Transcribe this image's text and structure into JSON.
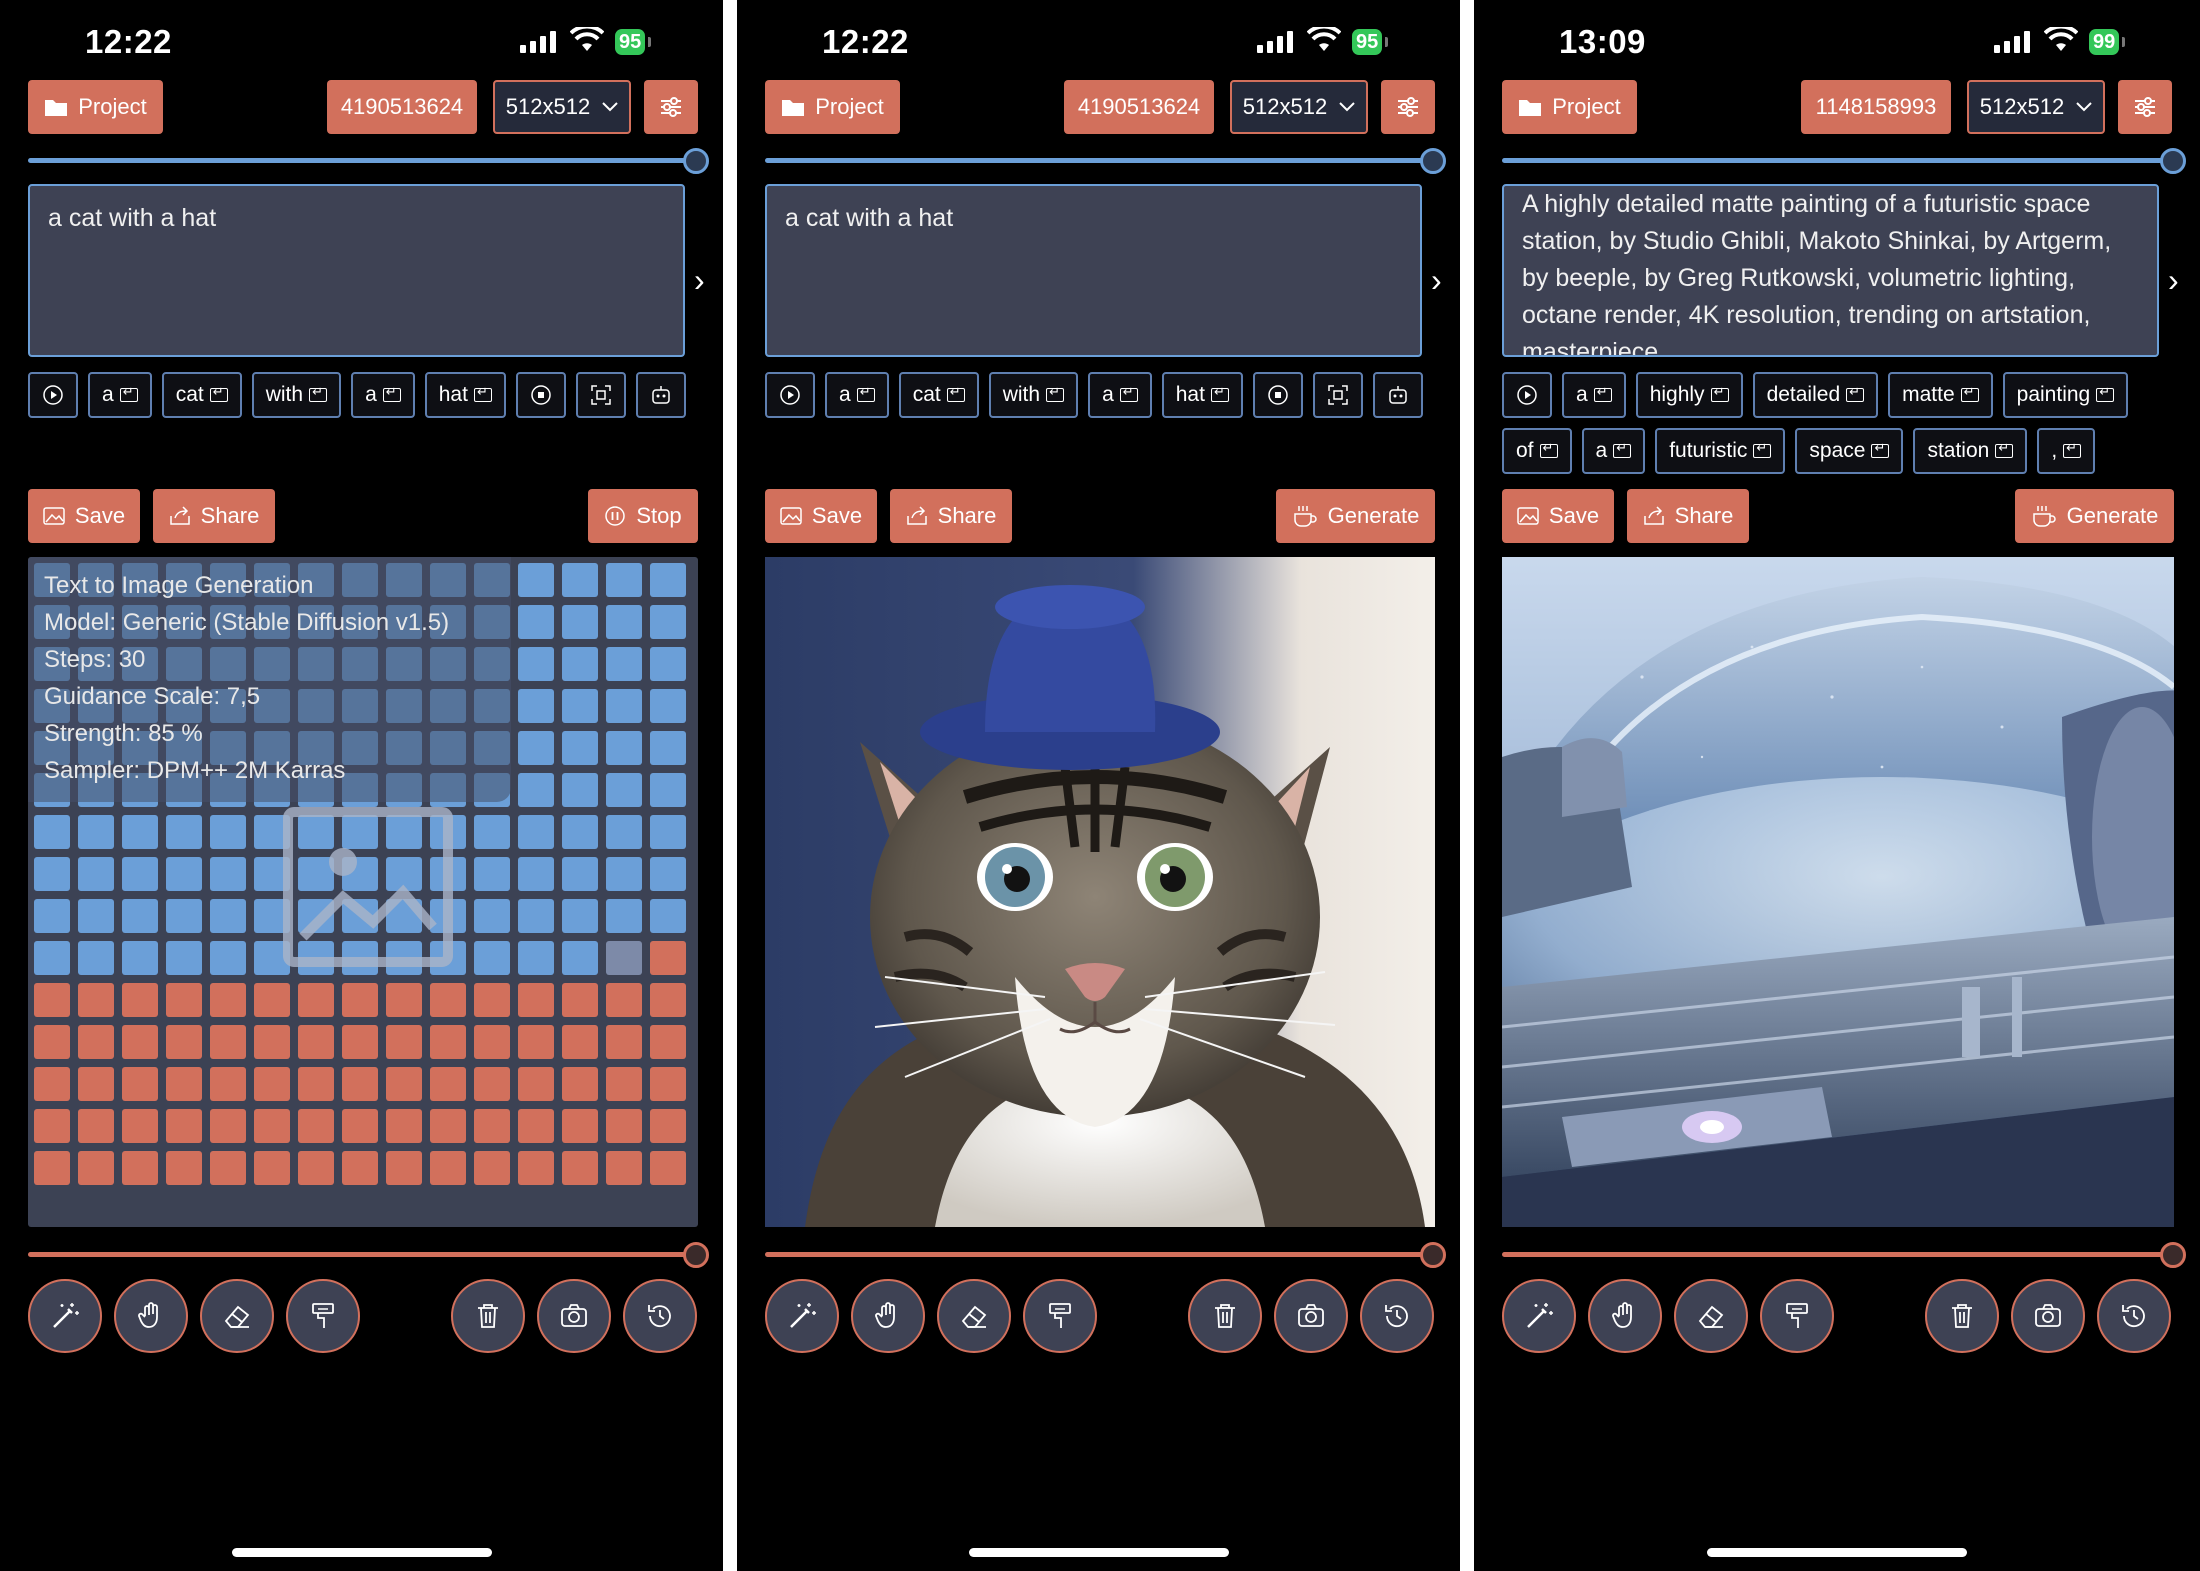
{
  "colors": {
    "accent": "#d2705c",
    "blue": "#6b9fd8",
    "panel": "#3e4254",
    "background": "#000000"
  },
  "screens": [
    {
      "time": "12:22",
      "battery": "95",
      "project_label": "Project",
      "seed": "4190513624",
      "size": "512x512",
      "prompt": "a cat with a hat",
      "chips": [
        "a",
        "cat",
        "with",
        "a",
        "hat"
      ],
      "save_label": "Save",
      "share_label": "Share",
      "action_label": "Stop",
      "info": {
        "line1": "Text to Image Generation",
        "line2": "Model: Generic (Stable Diffusion v1.5)",
        "line3": "Steps: 30",
        "line4": "Guidance Scale: 7,5",
        "line5": "Strength: 85 %",
        "line6": "Sampler: DPM++ 2M Karras"
      }
    },
    {
      "time": "12:22",
      "battery": "95",
      "project_label": "Project",
      "seed": "4190513624",
      "size": "512x512",
      "prompt": "a cat with a hat",
      "chips": [
        "a",
        "cat",
        "with",
        "a",
        "hat"
      ],
      "save_label": "Save",
      "share_label": "Share",
      "action_label": "Generate"
    },
    {
      "time": "13:09",
      "battery": "99",
      "project_label": "Project",
      "seed": "1148158993",
      "size": "512x512",
      "prompt": "A highly detailed matte painting of a futuristic space station, by Studio Ghibli, Makoto Shinkai, by Artgerm, by beeple, by Greg Rutkowski, volumetric lighting, octane render, 4K resolution, trending on artstation, masterpiece",
      "chips": [
        "a",
        "highly",
        "detailed",
        "matte",
        "painting",
        "of",
        "a",
        "futuristic",
        "space",
        "station",
        ","
      ],
      "save_label": "Save",
      "share_label": "Share",
      "action_label": "Generate"
    }
  ]
}
